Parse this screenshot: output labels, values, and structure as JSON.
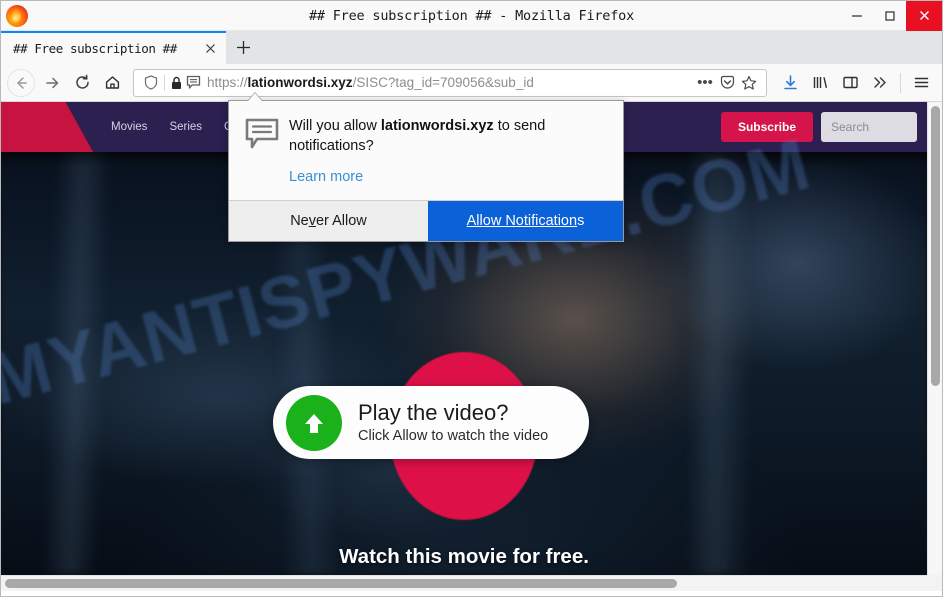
{
  "window": {
    "title": "## Free subscription ## - Mozilla Firefox",
    "minimize_label": "—",
    "maximize_label": "☐",
    "close_label": "✕"
  },
  "tabs": {
    "items": [
      {
        "label": "## Free subscription ##",
        "close_label": "✕"
      }
    ],
    "new_tab_label": "+"
  },
  "toolbar": {
    "back_label": "←",
    "forward_label": "→",
    "reload_label": "↻",
    "home_label": "⌂",
    "url": {
      "scheme": "https://",
      "host": "lationwordsi.xyz",
      "path": "/SISC?tag_id=709056&sub_id",
      "page_actions_label": "•••",
      "pocket_label": "pocket-icon",
      "bookmark_label": "☆"
    },
    "downloads_label": "downloads-icon",
    "library_label": "library-icon",
    "sidebar_label": "sidebar-icon",
    "overflow_label": "»",
    "menu_label": "☰"
  },
  "doorhanger": {
    "question_prefix": "Will you allow ",
    "question_domain": "lationwordsi.xyz",
    "question_suffix": " to send notifications?",
    "learn_more": "Learn more",
    "never_allow": "Never Allow",
    "never_allow_accesskey": "v",
    "allow": "Allow Notifications",
    "allow_accesskey": "A",
    "icon": "chat-notification-icon"
  },
  "site": {
    "nav": [
      {
        "label": "Movies"
      },
      {
        "label": "Series"
      },
      {
        "label": "C"
      }
    ],
    "subscribe_label": "Subscribe",
    "search_placeholder": "Search",
    "search_value": "",
    "watermark": "MYANTISPYWARE.COM",
    "play_card": {
      "title": "Play the video?",
      "subtitle": "Click Allow to watch the video",
      "button_icon": "up-arrow-icon"
    },
    "headline": "Watch this movie for free."
  },
  "colors": {
    "brand_crimson": "#d4144a",
    "header_purple": "#2b2050",
    "accent_blue": "#0a61d8",
    "play_green": "#1bb11b",
    "close_red": "#e81123",
    "circle_pink": "#dd1147"
  }
}
